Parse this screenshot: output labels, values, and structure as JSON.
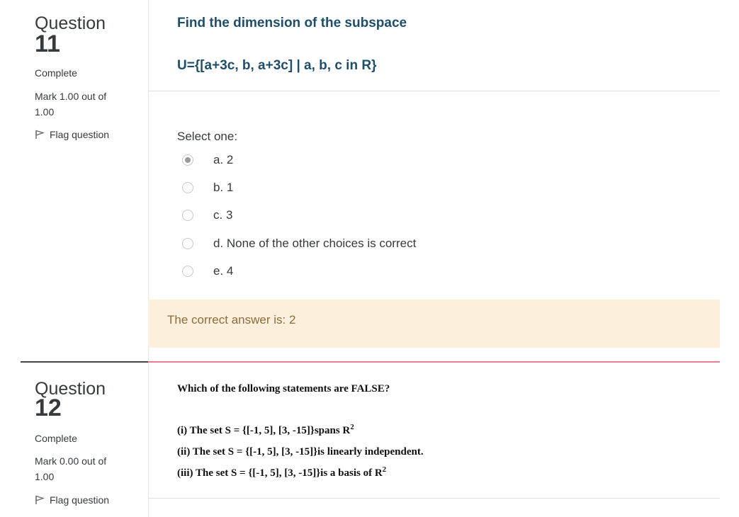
{
  "q11": {
    "question_word": "Question",
    "number": "11",
    "state": "Complete",
    "grade": "Mark 1.00 out of 1.00",
    "flag_label": "Flag question",
    "title": "Find the dimension of the subspace",
    "set": "U={[a+3c, b, a+3c] | a, b, c in R}",
    "select_label": "Select one:",
    "options": [
      {
        "label": "a. 2",
        "checked": true
      },
      {
        "label": "b. 1",
        "checked": false
      },
      {
        "label": "c. 3",
        "checked": false
      },
      {
        "label": "d. None of the other choices is correct",
        "checked": false
      },
      {
        "label": "e. 4",
        "checked": false
      }
    ],
    "feedback": "The correct answer is: 2"
  },
  "q12": {
    "question_word": "Question",
    "number": "12",
    "state": "Complete",
    "grade": "Mark 0.00 out of 1.00",
    "flag_label": "Flag question",
    "title": "Which of the following statements are FALSE?",
    "statements": {
      "s1": "(i) The set S = {[-1, 5], [3, -15]}spans R",
      "s1_sup": "2",
      "s2": "(ii) The set S = {[-1, 5], [3, -15]}is linearly independent.",
      "s3": "(iii) The set S = {[-1, 5], [3, -15]}is a basis of R",
      "s3_sup": "2"
    }
  },
  "colors": {
    "title_blue": "#1f4e6b",
    "feedback_bg": "#fcefdc",
    "feedback_text": "#8a6d3b",
    "divider_pink": "#e57f91"
  },
  "icons": {
    "flag": "flag-icon",
    "radio": "radio-icon"
  }
}
